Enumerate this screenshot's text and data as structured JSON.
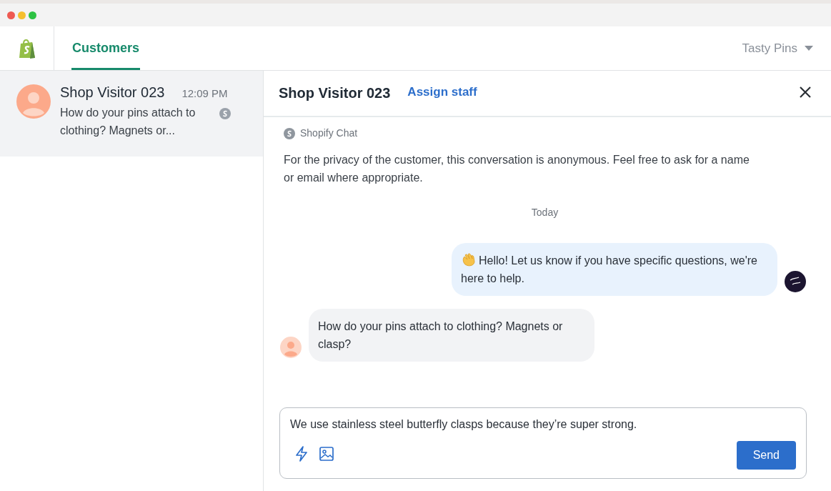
{
  "header": {
    "tabs": [
      {
        "label": "Customers",
        "selected": true
      }
    ],
    "store_menu": "Tasty Pins"
  },
  "conversations": [
    {
      "name": "Shop Visitor 023",
      "time": "12:09 PM",
      "preview": "How do your pins attach to clothing? Magnets or...",
      "selected": true
    }
  ],
  "chat": {
    "title": "Shop Visitor 023",
    "assign_link": "Assign staff",
    "source": "Shopify Chat",
    "notice": "For the privacy of the customer, this conversation is anonymous. Feel free to ask for a name or email where appropriate.",
    "day": "Today",
    "messages": [
      {
        "kind": "agent",
        "wave": true,
        "text": "Hello! Let us know if you have specific questions, we're here to help."
      },
      {
        "kind": "customer",
        "wave": false,
        "text": "How do your pins attach to clothing? Magnets or clasp?"
      }
    ],
    "composer": {
      "value": "We use stainless steel butterfly clasps because they’re super strong.",
      "send": "Send"
    }
  }
}
